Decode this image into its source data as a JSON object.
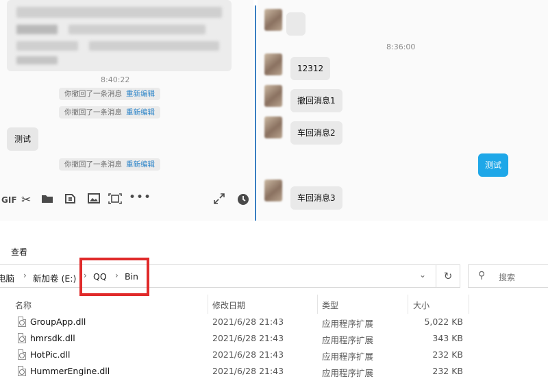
{
  "left_chat": {
    "timestamp": "8:40:22",
    "recall_notices": [
      {
        "text": "你撤回了一条消息",
        "action": "重新编辑"
      },
      {
        "text": "你撤回了一条消息",
        "action": "重新编辑"
      },
      {
        "text": "你撤回了一条消息",
        "action": "重新编辑"
      }
    ],
    "message": "测试"
  },
  "toolbar_icons": [
    "gif-icon",
    "scissors-icon",
    "folder-icon",
    "shake-icon",
    "image-icon",
    "screenshot-icon",
    "more-icon",
    "expand-icon",
    "history-clock-icon"
  ],
  "right_chat": {
    "timestamp": "8:36:00",
    "messages": [
      {
        "text": "12312"
      },
      {
        "text": "撤回消息1"
      },
      {
        "text": "车回消息2"
      },
      {
        "text": "车回消息3"
      }
    ],
    "sent_message": "测试"
  },
  "explorer": {
    "menu_view": "查看",
    "breadcrumb": [
      "电脑",
      "新加卷 (E:)",
      "QQ",
      "Bin"
    ],
    "search_placeholder": "搜索",
    "columns": [
      "名称",
      "修改日期",
      "类型",
      "大小"
    ],
    "files": [
      {
        "name": "GroupApp.dll",
        "date": "2021/6/28 21:43",
        "type": "应用程序扩展",
        "size": "5,022 KB"
      },
      {
        "name": "hmrsdk.dll",
        "date": "2021/6/28 21:43",
        "type": "应用程序扩展",
        "size": "343 KB"
      },
      {
        "name": "HotPic.dll",
        "date": "2021/6/28 21:43",
        "type": "应用程序扩展",
        "size": "232 KB"
      },
      {
        "name": "HummerEngine.dll",
        "date": "2021/6/28 21:43",
        "type": "应用程序扩展",
        "size": "232 KB"
      }
    ]
  },
  "colors": {
    "accent_blue": "#1ea7e8",
    "highlight_red": "#e02a2a",
    "link_blue": "#2f86c9"
  }
}
